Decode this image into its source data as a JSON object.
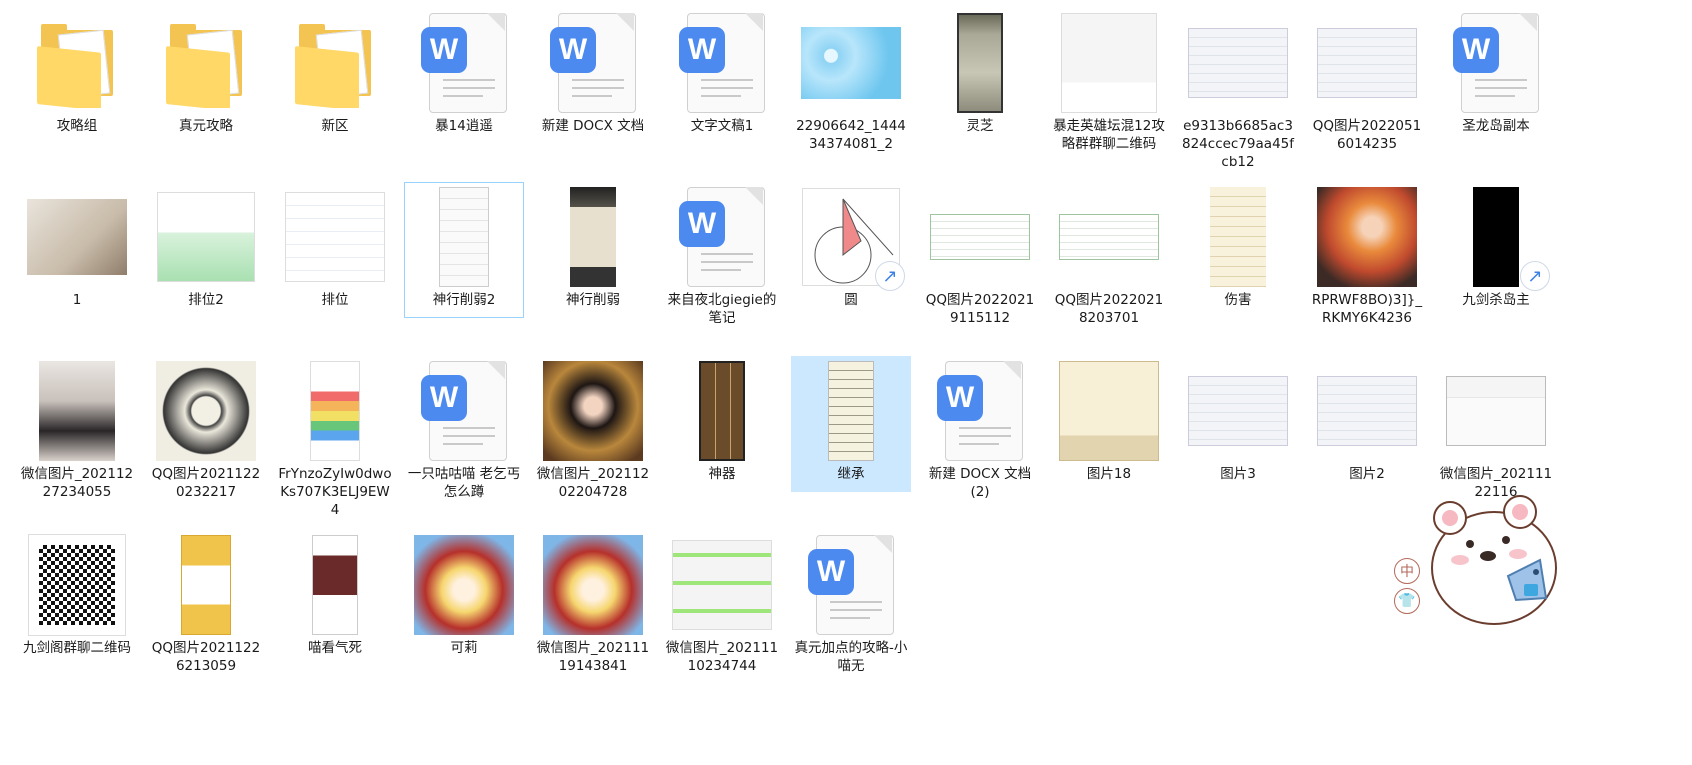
{
  "window": {
    "title": ""
  },
  "colors": {
    "selection": "#cce8ff",
    "focus_border": "#99d1ff",
    "wps_blue": "#4c8af0",
    "folder": "#f3c451"
  },
  "items": [
    {
      "name": "攻略组",
      "type": "folder",
      "thumb": "folder"
    },
    {
      "name": "真元攻略",
      "type": "folder",
      "thumb": "folder"
    },
    {
      "name": "新区",
      "type": "folder",
      "thumb": "folder"
    },
    {
      "name": "暴14逍遥",
      "type": "doc",
      "thumb": "wps-doc"
    },
    {
      "name": "新建 DOCX 文档",
      "type": "doc",
      "thumb": "wps-doc"
    },
    {
      "name": "文字文稿1",
      "type": "doc",
      "thumb": "wps-doc"
    },
    {
      "name": "22906642_144434374081_2",
      "type": "image",
      "thumb": "bunny-blue"
    },
    {
      "name": "灵芝",
      "type": "image",
      "thumb": "phone-screen"
    },
    {
      "name": "暴走英雄坛混12攻略群群聊二维码",
      "type": "image",
      "thumb": "qr-card"
    },
    {
      "name": "e9313b6685ac3824ccec79aa45fcb12",
      "type": "image",
      "thumb": "chat-screen"
    },
    {
      "name": "QQ图片20220516014235",
      "type": "image",
      "thumb": "chat-screen"
    },
    {
      "name": "圣龙岛副本",
      "type": "doc",
      "thumb": "wps-doc"
    },
    {
      "name": "1",
      "type": "image",
      "thumb": "photo-scissors"
    },
    {
      "name": "排位2",
      "type": "image",
      "thumb": "stats-chart"
    },
    {
      "name": "排位",
      "type": "image",
      "thumb": "list-screen"
    },
    {
      "name": "神行削弱2",
      "type": "image",
      "thumb": "phone-white",
      "state": "focus"
    },
    {
      "name": "神行削弱",
      "type": "image",
      "thumb": "phone-dark"
    },
    {
      "name": "来自夜北giegie的笔记",
      "type": "doc",
      "thumb": "wps-doc"
    },
    {
      "name": "圆",
      "type": "image",
      "thumb": "geometry",
      "shortcut": true
    },
    {
      "name": "QQ图片20220219115112",
      "type": "image",
      "thumb": "spreadsheet"
    },
    {
      "name": "QQ图片20220218203701",
      "type": "image",
      "thumb": "spreadsheet"
    },
    {
      "name": "伤害",
      "type": "image",
      "thumb": "cream-text"
    },
    {
      "name": "RPRWF8BO)3]}_RKMY6K4236",
      "type": "image",
      "thumb": "anime-girl"
    },
    {
      "name": "九剑杀岛主",
      "type": "image",
      "thumb": "black-screen",
      "shortcut": true
    },
    {
      "name": "微信图片_20211227234055",
      "type": "image",
      "thumb": "photo-person"
    },
    {
      "name": "QQ图片20211220232217",
      "type": "image",
      "thumb": "sketch"
    },
    {
      "name": "FrYnzoZyIw0dwoKs707K3ELJ9EW4",
      "type": "image",
      "thumb": "colorful-list"
    },
    {
      "name": "一只咕咕喵 老乞丐怎么蹲",
      "type": "doc",
      "thumb": "wps-doc"
    },
    {
      "name": "微信图片_20211202204728",
      "type": "image",
      "thumb": "anime-art"
    },
    {
      "name": "神器",
      "type": "image",
      "thumb": "game-grid"
    },
    {
      "name": "继承",
      "type": "image",
      "thumb": "cream-list",
      "state": "selected"
    },
    {
      "name": "新建 DOCX 文档 (2)",
      "type": "doc",
      "thumb": "wps-doc"
    },
    {
      "name": "图片18",
      "type": "image",
      "thumb": "game-cream"
    },
    {
      "name": "图片3",
      "type": "image",
      "thumb": "chat-screen"
    },
    {
      "name": "图片2",
      "type": "image",
      "thumb": "chat-screen"
    },
    {
      "name": "微信图片_20211122116",
      "type": "image",
      "thumb": "profile-screen"
    },
    {
      "name": "九剑阁群聊二维码",
      "type": "image",
      "thumb": "qr-card2"
    },
    {
      "name": "QQ图片20211226213059",
      "type": "image",
      "thumb": "yellow-qr"
    },
    {
      "name": "喵看气死",
      "type": "image",
      "thumb": "phone-art"
    },
    {
      "name": "可莉",
      "type": "image",
      "thumb": "klee"
    },
    {
      "name": "微信图片_20211119143841",
      "type": "image",
      "thumb": "klee"
    },
    {
      "name": "微信图片_20211110234744",
      "type": "image",
      "thumb": "wechat-chat"
    },
    {
      "name": "真元加点的攻略-小喵无",
      "type": "doc",
      "thumb": "wps-doc"
    }
  ],
  "ime": {
    "mode_label": "中",
    "skin_icon": "shirt-icon"
  }
}
